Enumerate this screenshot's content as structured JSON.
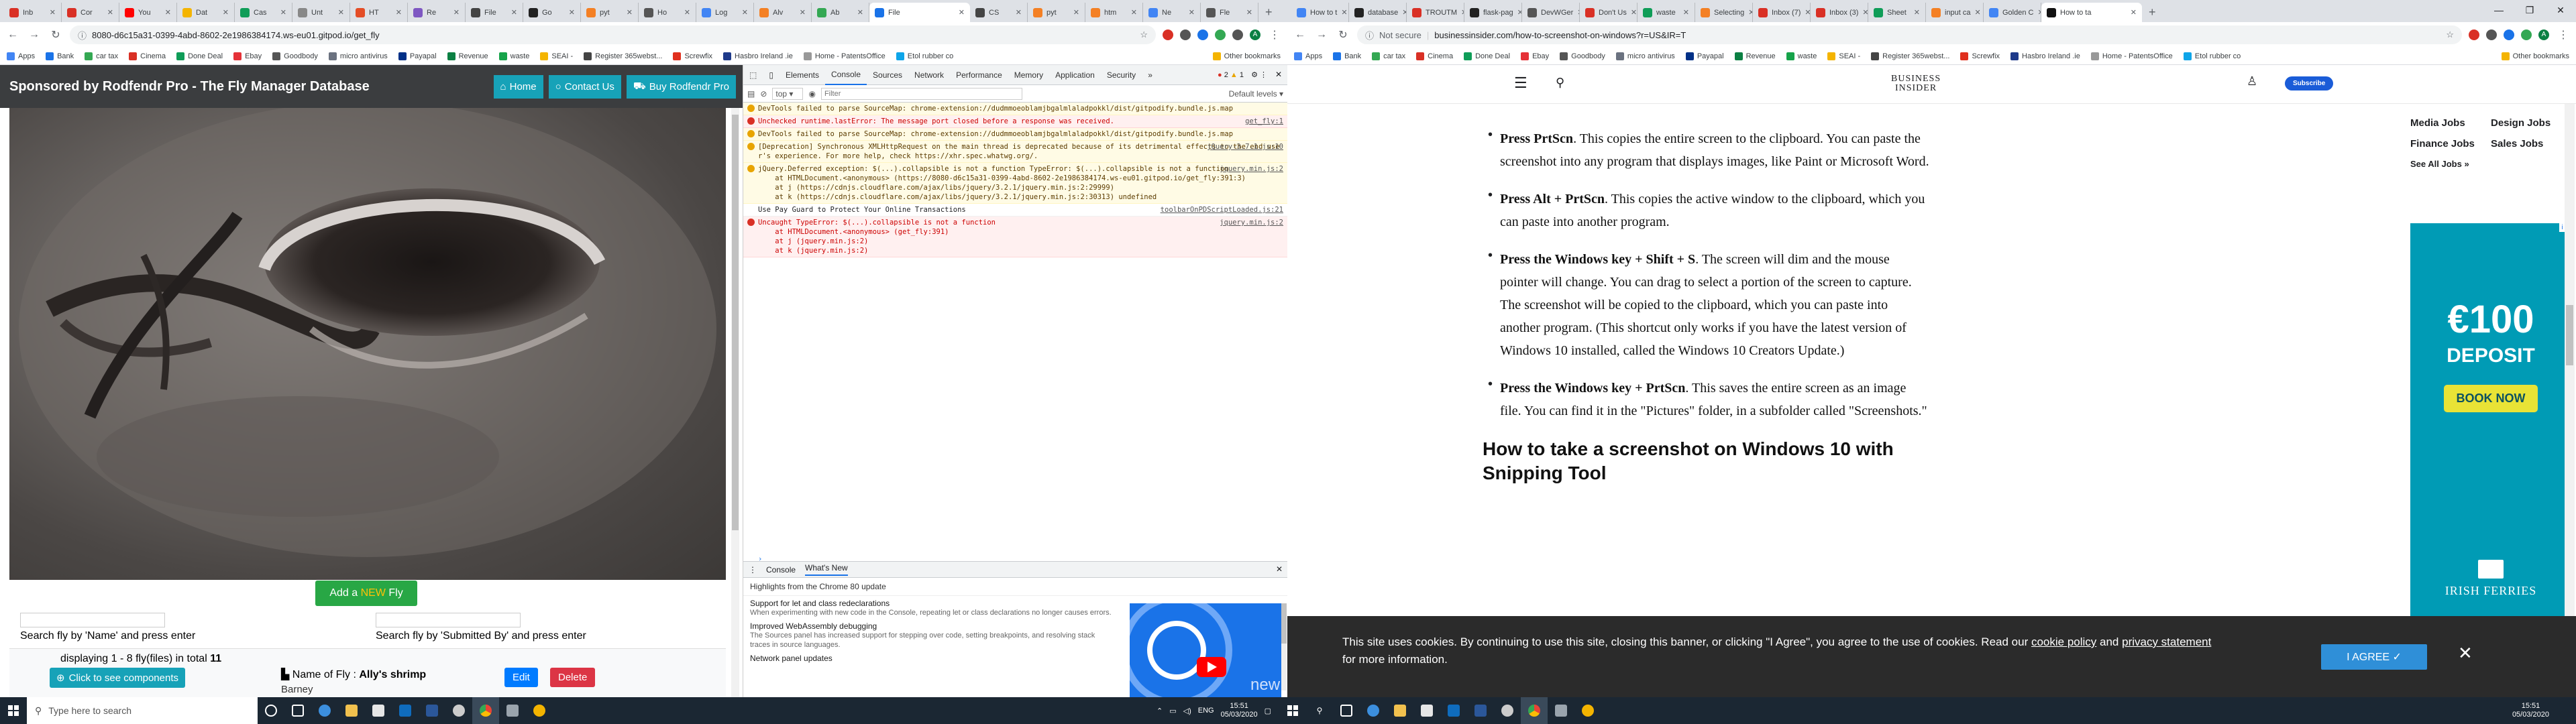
{
  "left_window": {
    "tabs": [
      {
        "title": "Inb",
        "color": "#d93025"
      },
      {
        "title": "Cor",
        "color": "#d93025"
      },
      {
        "title": "You",
        "color": "#ff0000"
      },
      {
        "title": "Dat",
        "color": "#f4b400"
      },
      {
        "title": "Cas",
        "color": "#0f9d58"
      },
      {
        "title": "Unt",
        "color": "#888888"
      },
      {
        "title": "HT",
        "color": "#e44d26"
      },
      {
        "title": "Re",
        "color": "#7e57c2"
      },
      {
        "title": "File",
        "color": "#444444"
      },
      {
        "title": "Go",
        "color": "#222222"
      },
      {
        "title": "pyt",
        "color": "#f48024"
      },
      {
        "title": "Ho",
        "color": "#555555"
      },
      {
        "title": "Log",
        "color": "#4285f4"
      },
      {
        "title": "Alv",
        "color": "#f48024"
      },
      {
        "title": "Ab",
        "color": "#34a853"
      },
      {
        "title": "File",
        "color": "#1a73e8",
        "active": true
      },
      {
        "title": "CS",
        "color": "#444444"
      },
      {
        "title": "pyt",
        "color": "#f48024"
      },
      {
        "title": "htm",
        "color": "#f48024"
      },
      {
        "title": "Ne",
        "color": "#4285f4"
      },
      {
        "title": "Fle",
        "color": "#555555"
      }
    ],
    "url": "8080-d6c15a31-0399-4abd-8602-2e1986384174.ws-eu01.gitpod.io/get_fly",
    "bookmarks": [
      "Apps",
      "Bank",
      "car tax",
      "Cinema",
      "Done Deal",
      "Ebay",
      "Goodbody",
      "micro antivirus",
      "Payapal",
      "Revenue",
      "waste",
      "SEAI -",
      "Register 365webst...",
      "Screwfix",
      "Hasbro Ireland .ie",
      "Home - PatentsOffice",
      "Etol rubber co"
    ],
    "bookmarks_other": "Other bookmarks",
    "fly_page": {
      "brand": "Sponsored by Rodfendr Pro - The Fly Manager Database",
      "nav_home": "Home",
      "nav_contact": "Contact Us",
      "nav_buy": "Buy Rodfendr Pro",
      "add_prefix": "Add a",
      "add_new": "NEW",
      "add_suffix": "Fly",
      "search_name_label": "Search fly by 'Name' and press enter",
      "search_submitted_label": "Search fly by 'Submitted By' and press enter",
      "displaying_prefix": "displaying 1 - 8 fly(files) in total",
      "displaying_count": "11",
      "components_btn": "Click to see components",
      "fly_name_label": "Name of Fly :",
      "fly_name": "Ally's shrimp",
      "submitted_by": "Barney",
      "edit_btn": "Edit",
      "delete_btn": "Delete"
    },
    "devtools": {
      "tabs": [
        "Elements",
        "Console",
        "Sources",
        "Network",
        "Performance",
        "Memory",
        "Application",
        "Security"
      ],
      "active_tab": "Console",
      "more": "»",
      "error_count": "2",
      "warn_count": "1",
      "context": "top",
      "filter_placeholder": "Filter",
      "levels": "Default levels",
      "lines": [
        {
          "kind": "warn",
          "text": "DevTools failed to parse SourceMap: chrome-extension://dudmmoeoblamjbgalmlaladpokkl/dist/gitpodify.bundle.js.map",
          "src": ""
        },
        {
          "kind": "err",
          "text": "Unchecked runtime.lastError: The message port closed before a response was received.",
          "src": "get_fly:1"
        },
        {
          "kind": "warn",
          "text": "DevTools failed to parse SourceMap: chrome-extension://dudmmoeoblamjbgalmlaladpokkl/dist/gitpodify.bundle.js.map",
          "src": ""
        },
        {
          "kind": "warn",
          "text": "[Deprecation] Synchronous XMLHttpRequest on the main thread is deprecated because of its detrimental effects to the end user's experience. For more help, check https://xhr.spec.whatwg.org/.",
          "src": "jQuery-3.7.1.js:10"
        },
        {
          "kind": "warn",
          "text": "jQuery.Deferred exception: $(...).collapsible is not a function TypeError: $(...).collapsible is not a function\n    at HTMLDocument.<anonymous> (https://8080-d6c15a31-0399-4abd-8602-2e1986384174.ws-eu01.gitpod.io/get_fly:391:3)\n    at j (https://cdnjs.cloudflare.com/ajax/libs/jquery/3.2.1/jquery.min.js:2:29999)\n    at k (https://cdnjs.cloudflare.com/ajax/libs/jquery/3.2.1/jquery.min.js:2:30313) undefined",
          "src": "jquery.min.js:2"
        },
        {
          "kind": "info",
          "text": "Use Pay Guard to Protect Your Online Transactions",
          "src": "toolbarOnPDScriptLoaded.js:21"
        },
        {
          "kind": "err",
          "text": "Uncaught TypeError: $(...).collapsible is not a function\n    at HTMLDocument.<anonymous> (get_fly:391)\n    at j (jquery.min.js:2)\n    at k (jquery.min.js:2)",
          "src": "jquery.min.js:2"
        }
      ],
      "drawer_tabs": [
        "Console",
        "What's New"
      ],
      "drawer_active": "What's New",
      "drawer_heading": "Highlights from the Chrome 80 update",
      "news": [
        {
          "title": "Support for let and class redeclarations",
          "body": "When experimenting with new code in the Console, repeating let or class declarations no longer causes errors."
        },
        {
          "title": "Improved WebAssembly debugging",
          "body": "The Sources panel has increased support for stepping over code, setting breakpoints, and resolving stack traces in source languages."
        },
        {
          "title": "Network panel updates",
          "body": ""
        }
      ],
      "video_text": "new"
    }
  },
  "right_window": {
    "tabs": [
      {
        "title": "How to t",
        "color": "#4285f4"
      },
      {
        "title": "database",
        "color": "#222222"
      },
      {
        "title": "TROUTM",
        "color": "#d93025"
      },
      {
        "title": "flask-pag",
        "color": "#222222"
      },
      {
        "title": "DevWGer",
        "color": "#555555"
      },
      {
        "title": "Don't Us",
        "color": "#d93025"
      },
      {
        "title": "waste",
        "color": "#0f9d58"
      },
      {
        "title": "Selecting",
        "color": "#f48024"
      },
      {
        "title": "Inbox (7)",
        "color": "#d93025"
      },
      {
        "title": "Inbox (3)",
        "color": "#d93025"
      },
      {
        "title": "Sheet",
        "color": "#0f9d58"
      },
      {
        "title": "input ca",
        "color": "#f48024"
      },
      {
        "title": "Golden C",
        "color": "#4285f4"
      },
      {
        "title": "How to ta",
        "color": "#111111",
        "active": true
      }
    ],
    "url_secure": "Not secure",
    "url": "businessinsider.com/how-to-screenshot-on-windows?r=US&IR=T",
    "bookmarks": [
      "Apps",
      "Bank",
      "car tax",
      "Cinema",
      "Done Deal",
      "Ebay",
      "Goodbody",
      "micro antivirus",
      "Payapal",
      "Revenue",
      "waste",
      "SEAI -",
      "Register 365webst...",
      "Screwfix",
      "Hasbro Ireland .ie",
      "Home - PatentsOffice",
      "Etol rubber co"
    ],
    "bookmarks_other": "Other bookmarks",
    "bi": {
      "logo_line1": "BUSINESS",
      "logo_line2": "INSIDER",
      "subscribe": "Subscribe",
      "bullets": [
        {
          "bold": "Press PrtScn",
          "text": ". This copies the entire screen to the clipboard. You can paste the screenshot into any program that displays images, like Paint or Microsoft Word."
        },
        {
          "bold": "Press Alt + PrtScn",
          "text": ". This copies the active window to the clipboard, which you can paste into another program."
        },
        {
          "bold": "Press the Windows key + Shift + S",
          "text": ". The screen will dim and the mouse pointer will change. You can drag to select a portion of the screen to capture. The screenshot will be copied to the clipboard, which you can paste into another program. (This shortcut only works if you have the latest version of Windows 10 installed, called the Windows 10 Creators Update.)"
        },
        {
          "bold": "Press the Windows key + PrtScn",
          "text": ". This saves the entire screen as an image file. You can find it in the \"Pictures\" folder, in a subfolder called \"Screenshots.\""
        }
      ],
      "h2": "How to take a screenshot on Windows 10 with Snipping Tool",
      "jobs": [
        "Media Jobs",
        "Design Jobs",
        "Finance Jobs",
        "Sales Jobs"
      ],
      "see_all": "See All Jobs »",
      "ad_amount": "€100",
      "ad_deposit": "DEPOSIT",
      "ad_book": "BOOK NOW",
      "ad_brand": "IRISH FERRIES",
      "ad_corner": "i X",
      "cookie_text_pre": "This site uses cookies. By continuing to use this site, closing this banner, or clicking \"I Agree\", you agree to the use of cookies. Read our ",
      "cookie_policy": "cookie policy",
      "cookie_and": " and ",
      "cookie_privacy": "privacy statement",
      "cookie_text_post": " for more information.",
      "agree": "I AGREE ✓"
    }
  },
  "taskbar": {
    "search_placeholder": "Type here to search",
    "left_time": "15:51",
    "left_date": "05/03/2020",
    "left_lang": "ENG",
    "right_time": "15:51",
    "right_date": "05/03/2020"
  },
  "colors": {
    "chrome_tabstrip": "#dee1e6",
    "fly_header": "#3b3d3f",
    "info": "#17a2b8",
    "success": "#28a745",
    "danger": "#dc3545",
    "primary": "#007bff",
    "ad_teal": "#009bb5",
    "ad_book": "#e8e336",
    "cookie_bg": "#2b2b2b",
    "agree": "#2f8fd8",
    "taskbar": "#1b2733"
  }
}
